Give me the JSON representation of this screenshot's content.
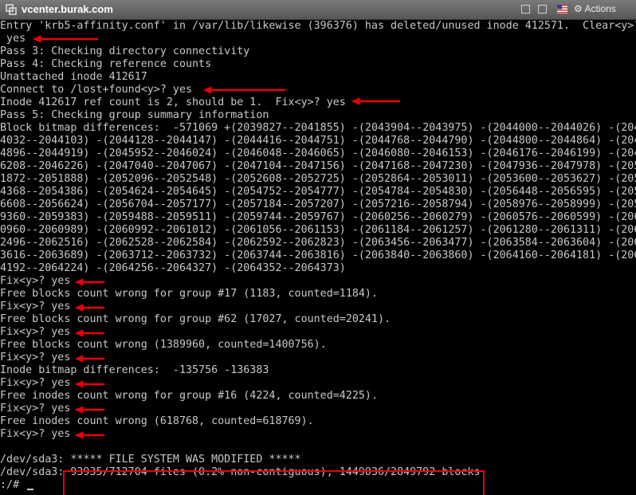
{
  "window": {
    "title": "vcenter.burak.com",
    "actions_label": "Actions"
  },
  "icons": {
    "logo": "vmware-logo-icon",
    "gear": "gear-icon",
    "flag": "us-flag-icon"
  },
  "colors": {
    "terminal_fg": "#c8c8c8",
    "terminal_bg": "#000000",
    "annotation": "#e8000a"
  },
  "console": {
    "lines": [
      "Entry 'krb5-affinity.conf' in /var/lib/likewise (396376) has deleted/unused inode 412571.  Clear<y>?",
      " yes",
      "Pass 3: Checking directory connectivity",
      "Pass 4: Checking reference counts",
      "Unattached inode 412617",
      "Connect to /lost+found<y>? yes",
      "Inode 412617 ref count is 2, should be 1.  Fix<y>? yes",
      "Pass 5: Checking group summary information",
      "Block bitmap differences:  -571069 +(2039827--2041855) -(2043904--2043975) -(2044000--2044026) -(204",
      "4032--2044103) -(2044128--2044147) -(2044416--2044751) -(2044768--2044790) -(2044800--2044864) -(204",
      "4896--2044919) -(2045952--2046024) -(2046048--2046065) -(2046080--2046153) -(2046176--2046199) -(204",
      "6208--2046226) -(2047040--2047067) -(2047104--2047156) -(2047168--2047230) -(2047936--2047978) -(205",
      "1872--2051888) -(2052096--2052548) -(2052608--2052725) -(2052864--2053011) -(2053600--2053627) -(205",
      "4368--2054386) -(2054624--2054645) -(2054752--2054777) -(2054784--2054830) -(2056448--2056595) -(205",
      "6608--2056624) -(2056704--2057177) -(2057184--2057207) -(2057216--2058794) -(2058976--2058999) -(205",
      "9360--2059383) -(2059488--2059511) -(2059744--2059767) -(2060256--2060279) -(2060576--2060599) -(206",
      "0960--2060989) -(2060992--2061012) -(2061056--2061153) -(2061184--2061257) -(2061280--2061311) -(206",
      "2496--2062516) -(2062528--2062584) -(2062592--2062823) -(2063456--2063477) -(2063584--2063604) -(206",
      "3616--2063689) -(2063712--2063732) -(2063744--2063816) -(2063840--2063860) -(2064160--2064181) -(206",
      "4192--2064224) -(2064256--2064327) -(2064352--2064373)",
      "Fix<y>? yes",
      "Free blocks count wrong for group #17 (1183, counted=1184).",
      "Fix<y>? yes",
      "Free blocks count wrong for group #62 (17027, counted=20241).",
      "Fix<y>? yes",
      "Free blocks count wrong (1389960, counted=1400756).",
      "Fix<y>? yes",
      "Inode bitmap differences:  -135756 -136383",
      "Fix<y>? yes",
      "Free inodes count wrong for group #16 (4224, counted=4225).",
      "Fix<y>? yes",
      "Free inodes count wrong (618768, counted=618769).",
      "Fix<y>? yes",
      "",
      "/dev/sda3: ***** FILE SYSTEM WAS MODIFIED *****",
      "/dev/sda3: 93935/712704 files (0.2% non-contiguous), 1449036/2849792 blocks",
      ":/# "
    ]
  }
}
